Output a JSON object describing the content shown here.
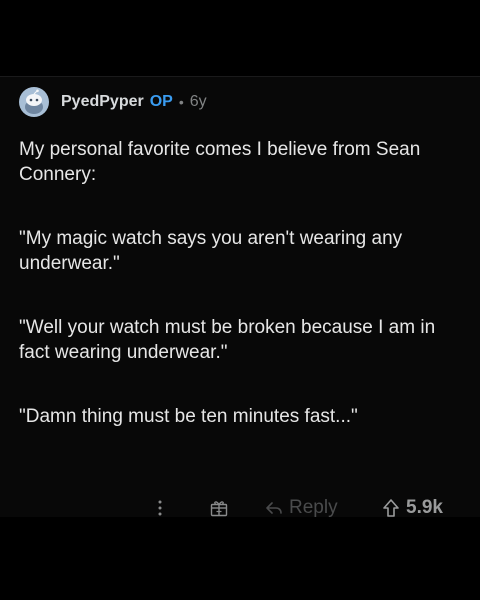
{
  "comment": {
    "author": "PyedPyper",
    "op_badge": "OP",
    "separator": "•",
    "age": "6y",
    "paragraphs": [
      "My personal favorite comes I believe from Sean Connery:",
      "\"My magic watch says you aren't wearing any underwear.\"",
      "\"Well your watch must be broken because I am in fact wearing underwear.\"",
      "\"Damn thing must be ten minutes fast...\""
    ]
  },
  "actions": {
    "more_icon": "more-vertical-icon",
    "award_icon": "gift-icon",
    "reply_label": "Reply",
    "reply_icon": "reply-arrow-icon",
    "upvote_icon": "upvote-arrow-icon",
    "vote_count": "5.9k"
  },
  "colors": {
    "background": "#000000",
    "op_badge": "#3a9cf0",
    "text": "#e6e6e6",
    "muted": "#818384"
  }
}
